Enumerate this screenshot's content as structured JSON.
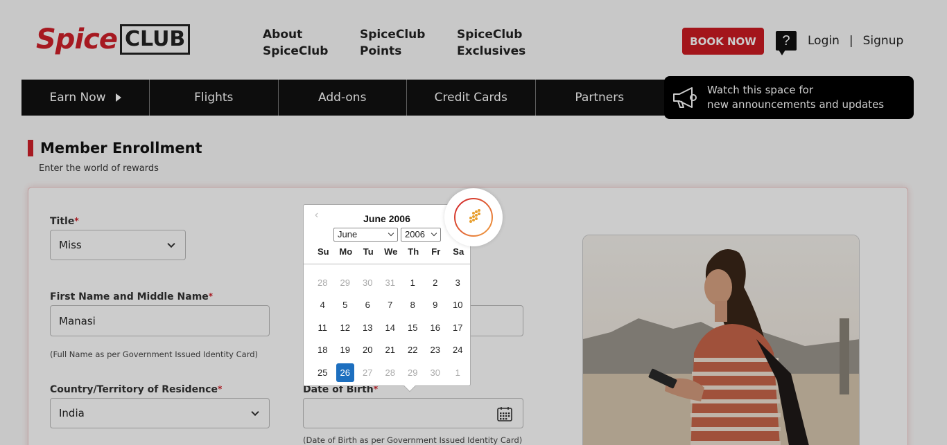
{
  "header": {
    "logo": {
      "spice": "Spice",
      "club": "CLUB"
    },
    "nav": [
      {
        "line1": "About",
        "line2": "SpiceClub"
      },
      {
        "line1": "SpiceClub",
        "line2": "Points"
      },
      {
        "line1": "SpiceClub",
        "line2": "Exclusives"
      }
    ],
    "book_now": "BOOK NOW",
    "help": "?",
    "login": "Login",
    "separator": "|",
    "signup": "Signup"
  },
  "menu": {
    "items": [
      "Earn Now",
      "Flights",
      "Add-ons",
      "Credit Cards",
      "Partners"
    ],
    "announcement_line1": "Watch this space for",
    "announcement_line2": "new announcements and updates"
  },
  "page": {
    "title": "Member Enrollment",
    "subtitle": "Enter the world of rewards"
  },
  "form": {
    "title_label": "Title",
    "title_value": "Miss",
    "first_name_label": "First Name and Middle Name",
    "first_name_value": "Manasi",
    "first_name_hint": "(Full Name as per Government Issued Identity Card)",
    "country_label": "Country/Territory of Residence",
    "country_value": "India",
    "dob_label": "Date of Birth",
    "dob_value": "",
    "dob_hint": "(Date of Birth as per Government Issued Identity Card)",
    "required_mark": "*"
  },
  "datepicker": {
    "title": "June 2006",
    "month_select": "June",
    "year_select": "2006",
    "weekdays": [
      "Su",
      "Mo",
      "Tu",
      "We",
      "Th",
      "Fr",
      "Sa"
    ],
    "days": [
      [
        "28",
        "29",
        "30",
        "31",
        "1",
        "2",
        "3"
      ],
      [
        "4",
        "5",
        "6",
        "7",
        "8",
        "9",
        "10"
      ],
      [
        "11",
        "12",
        "13",
        "14",
        "15",
        "16",
        "17"
      ],
      [
        "18",
        "19",
        "20",
        "21",
        "22",
        "23",
        "24"
      ],
      [
        "25",
        "26",
        "27",
        "28",
        "29",
        "30",
        "1"
      ]
    ],
    "selected_day": "26",
    "prev_icon": "chevron-left-icon"
  },
  "colors": {
    "brand_red": "#d0202a",
    "selected_blue": "#1d6fbf"
  }
}
